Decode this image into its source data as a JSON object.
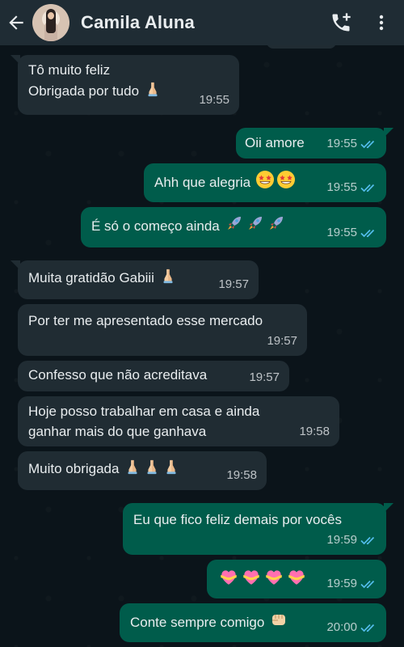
{
  "header": {
    "contact_name": "Camila Aluna",
    "back_icon": "arrow-left-icon",
    "call_icon": "add-call-icon",
    "menu_icon": "more-vert-icon"
  },
  "colors": {
    "header_bg": "#1f2c34",
    "chat_bg": "#0b141a",
    "incoming_bubble": "#202c33",
    "outgoing_bubble": "#005c4b",
    "read_ticks": "#53bdeb"
  },
  "messages": [
    {
      "dir": "in",
      "lines": [
        "Tô muito feliz",
        "Obrigada por tudo"
      ],
      "emoji": [
        "folded-hands"
      ],
      "time": "19:55"
    },
    {
      "dir": "out",
      "text": "Oii amore",
      "time": "19:55"
    },
    {
      "dir": "out",
      "text": "Ahh que alegria",
      "emoji": [
        "star-struck",
        "star-struck"
      ],
      "time": "19:55"
    },
    {
      "dir": "out",
      "text": "É só o começo ainda",
      "emoji": [
        "rocket",
        "rocket",
        "rocket"
      ],
      "time": "19:55"
    },
    {
      "dir": "in",
      "text": "Muita gratidão Gabiii",
      "emoji": [
        "folded-hands"
      ],
      "time": "19:57"
    },
    {
      "dir": "in",
      "text": "Por ter me apresentado esse mercado",
      "time": "19:57"
    },
    {
      "dir": "in",
      "text": "Confesso que não acreditava",
      "time": "19:57"
    },
    {
      "dir": "in",
      "lines": [
        "Hoje posso trabalhar em casa e ainda",
        "ganhar mais do que ganhava"
      ],
      "time": "19:58"
    },
    {
      "dir": "in",
      "text": "Muito obrigada",
      "emoji": [
        "folded-hands",
        "folded-hands",
        "folded-hands"
      ],
      "time": "19:58"
    },
    {
      "dir": "out",
      "text": "Eu que fico feliz demais por vocês",
      "time": "19:59"
    },
    {
      "dir": "out",
      "text": "",
      "emoji": [
        "heart-with-ribbon",
        "heart-with-ribbon",
        "heart-with-ribbon",
        "heart-with-ribbon"
      ],
      "time": "19:59"
    },
    {
      "dir": "out",
      "text": "Conte sempre comigo",
      "emoji": [
        "oncoming-fist"
      ],
      "time": "20:00"
    }
  ]
}
